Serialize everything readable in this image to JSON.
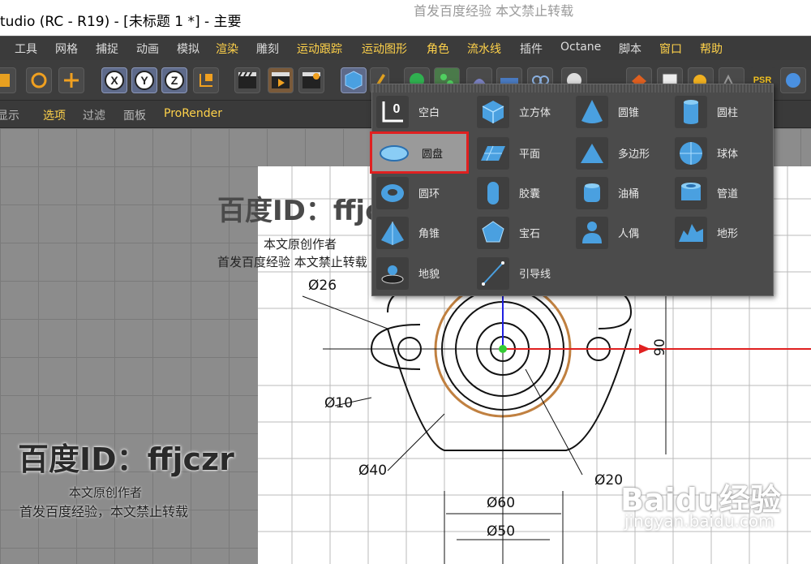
{
  "window": {
    "title": "tudio (RC - R19) - [未标题 1 *] - 主要"
  },
  "watermark_top": "首发百度经验    本文禁止转载",
  "menu": [
    {
      "label": "工具",
      "highlight": false
    },
    {
      "label": "网格",
      "highlight": false
    },
    {
      "label": "捕捉",
      "highlight": false
    },
    {
      "label": "动画",
      "highlight": false
    },
    {
      "label": "模拟",
      "highlight": false
    },
    {
      "label": "渲染",
      "highlight": true
    },
    {
      "label": "雕刻",
      "highlight": false
    },
    {
      "label": "运动跟踪",
      "highlight": true
    },
    {
      "label": "运动图形",
      "highlight": true
    },
    {
      "label": "角色",
      "highlight": true
    },
    {
      "label": "流水线",
      "highlight": true
    },
    {
      "label": "插件",
      "highlight": false
    },
    {
      "label": "Octane",
      "highlight": false
    },
    {
      "label": "脚本",
      "highlight": false
    },
    {
      "label": "窗口",
      "highlight": true
    },
    {
      "label": "帮助",
      "highlight": true
    }
  ],
  "toolbar": {
    "psr_label": "PSR"
  },
  "subbar": [
    {
      "label": "显示",
      "highlight": false
    },
    {
      "label": "选项",
      "highlight": true
    },
    {
      "label": "过滤",
      "highlight": false
    },
    {
      "label": "面板",
      "highlight": false
    },
    {
      "label": "ProRender",
      "highlight": true
    }
  ],
  "popup": {
    "items": [
      {
        "label": "空白",
        "icon": "null-object-icon"
      },
      {
        "label": "立方体",
        "icon": "cube-icon"
      },
      {
        "label": "圆锥",
        "icon": "cone-icon"
      },
      {
        "label": "圆柱",
        "icon": "cylinder-icon"
      },
      {
        "label": "圆盘",
        "icon": "disc-icon",
        "selected": true
      },
      {
        "label": "平面",
        "icon": "plane-icon"
      },
      {
        "label": "多边形",
        "icon": "polygon-icon"
      },
      {
        "label": "球体",
        "icon": "sphere-icon"
      },
      {
        "label": "圆环",
        "icon": "torus-icon"
      },
      {
        "label": "胶囊",
        "icon": "capsule-icon"
      },
      {
        "label": "油桶",
        "icon": "oil-tank-icon"
      },
      {
        "label": "管道",
        "icon": "tube-icon"
      },
      {
        "label": "角锥",
        "icon": "pyramid-icon"
      },
      {
        "label": "宝石",
        "icon": "platonic-icon"
      },
      {
        "label": "人偶",
        "icon": "figure-icon"
      },
      {
        "label": "地形",
        "icon": "landscape-icon"
      },
      {
        "label": "地貌",
        "icon": "relief-icon"
      },
      {
        "label": "引导线",
        "icon": "guide-icon"
      }
    ]
  },
  "watermarks": {
    "id_text": "百度ID：ffjczr",
    "author": "本文原创作者",
    "rule": "首发百度经验    本文禁止转载",
    "rule2": "首发百度经验，本文禁止转载",
    "baidu_logo": "Baidu经验",
    "baidu_url": "jingyan.baidu.com"
  },
  "dimensions": {
    "d26": "Ø26",
    "d10": "Ø10",
    "d40": "Ø40",
    "d20": "Ø20",
    "d60": "Ø60",
    "d50": "Ø50",
    "h90": "90"
  },
  "colors": {
    "accent": "#ffd24a",
    "selection": "#e02020",
    "axis_x": "#e02020",
    "axis_y": "#2020e0",
    "disc_outline": "#c08040"
  }
}
